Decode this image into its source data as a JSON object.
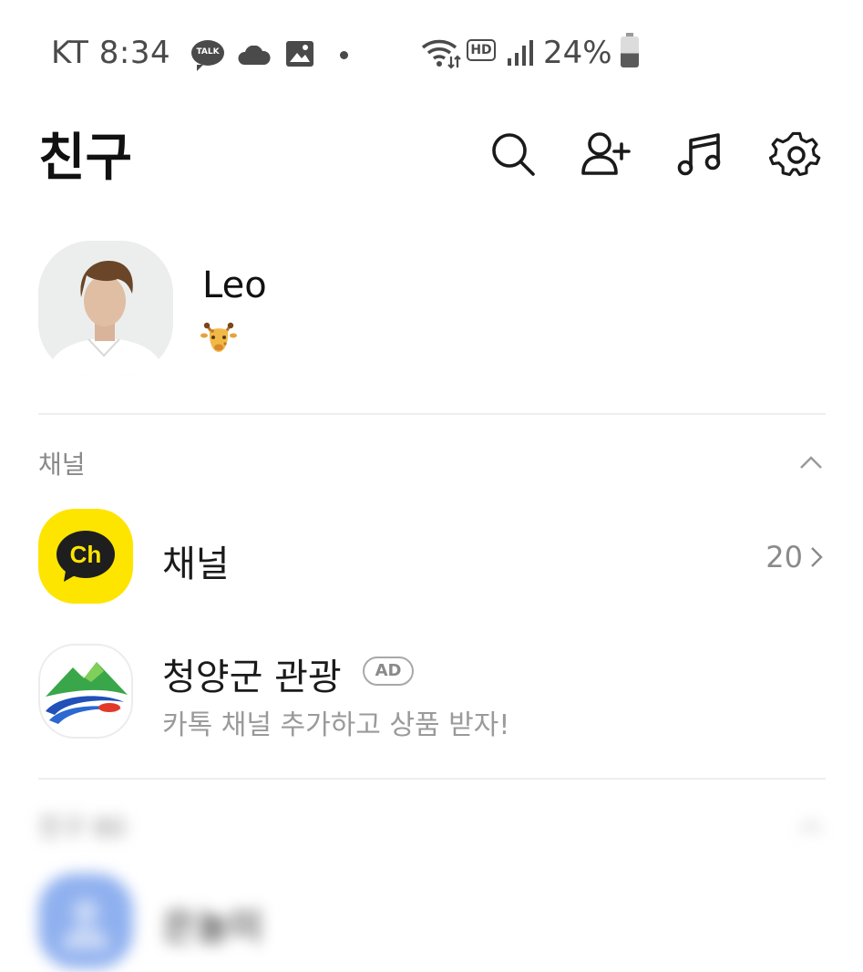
{
  "status_bar": {
    "carrier_time": "KT 8:34",
    "talk_badge": "TALK",
    "network_badge": "HD",
    "battery_percent": "24%",
    "icons": [
      "talk-icon",
      "cloud-icon",
      "gallery-icon",
      "dot-icon",
      "wifi-icon",
      "hd-voice-icon",
      "signal-icon",
      "battery-icon"
    ]
  },
  "header": {
    "title": "친구",
    "actions": [
      "search-icon",
      "add-friend-icon",
      "music-icon",
      "settings-icon"
    ]
  },
  "profile": {
    "name": "Leo",
    "status_emoji": "🦒"
  },
  "channel_section": {
    "label": "채널",
    "items": [
      {
        "title": "채널",
        "count": "20",
        "icon_text": "Ch",
        "icon_color": "#FEE500"
      },
      {
        "title": "청양군 관광",
        "badge": "AD",
        "subtitle": "카톡 채널 추가하고 상품 받자!"
      }
    ]
  },
  "friends_section": {
    "label": "친구 80",
    "first_friend": "은놀미"
  },
  "colors": {
    "accent_yellow": "#FEE500",
    "friend_avatar": "#8fb0ef"
  }
}
